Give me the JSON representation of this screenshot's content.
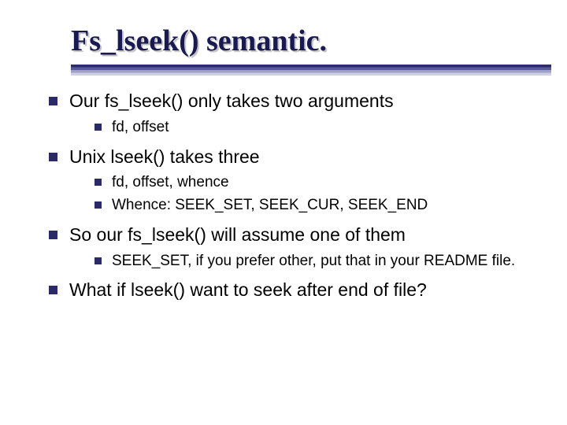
{
  "title": "Fs_lseek() semantic.",
  "bullets": [
    {
      "text": "Our fs_lseek() only takes two arguments",
      "sub": [
        {
          "text": "fd, offset"
        }
      ]
    },
    {
      "text": "Unix lseek() takes three",
      "sub": [
        {
          "text": "fd, offset, whence"
        },
        {
          "text": "Whence: SEEK_SET, SEEK_CUR, SEEK_END"
        }
      ]
    },
    {
      "text": "So our fs_lseek() will assume one of them",
      "sub": [
        {
          "text": "SEEK_SET, if you prefer other, put that in your README file."
        }
      ]
    },
    {
      "text": "What if lseek() want to seek after end of file?",
      "sub": []
    }
  ]
}
